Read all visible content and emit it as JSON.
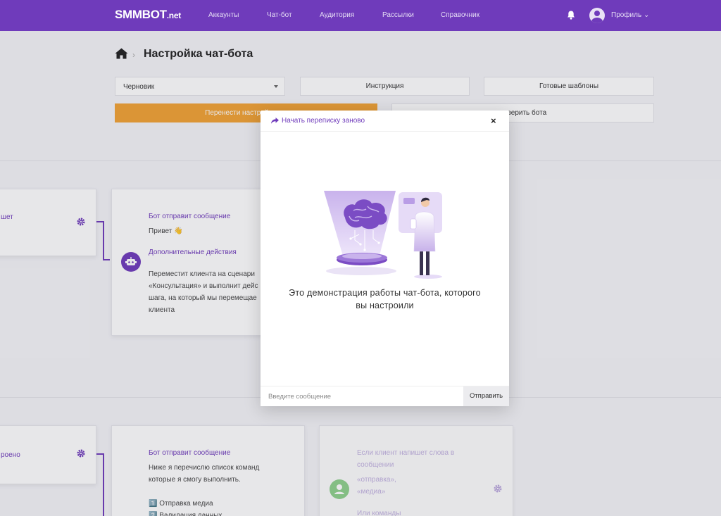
{
  "nav": {
    "brand_main": "SMMBOT",
    "brand_suffix": ".net",
    "links": [
      "Аккаунты",
      "Чат-бот",
      "Аудитория",
      "Рассылки",
      "Справочник"
    ],
    "profile": "Профиль ⌄",
    "accent": "#6f3bbb"
  },
  "page": {
    "title": "Настройка чат-бота"
  },
  "controls": {
    "draft_select": "Черновик",
    "instruction": "Инструкция",
    "templates": "Готовые шаблоны",
    "transfer": "Перенести настройки в о",
    "check_bot": "оверить бота"
  },
  "flow": {
    "left_top_label": "шет",
    "left_bottom_label": "роено",
    "card1": {
      "title": "Бот отправит сообщение",
      "greeting": "Привет 👋",
      "actions_title": "Дополнительные действия",
      "lines": [
        "Переместит клиента на сценари",
        "«Консультация» и выполнит дейс",
        "шага, на который мы перемещае",
        "клиента"
      ]
    },
    "card2": {
      "title": "Бот отправит сообщение",
      "lines": [
        "Ниже я перечислю список команд",
        "которые я смогу выполнить.",
        "",
        "1️⃣ Отправка медиа",
        "2️⃣ Валидация данных"
      ]
    },
    "card3": {
      "lines": [
        "Если клиент напишет слова в",
        "сообщении",
        "«отправка»,",
        "«медиа»",
        "",
        "Или команды"
      ]
    }
  },
  "modal": {
    "restart": "Начать переписку заново",
    "close": "×",
    "demo_line1": "Это демонстрация работы чат-бота, которого",
    "demo_line2": "вы настроили",
    "input_placeholder": "Введите сообщение",
    "send": "Отправить"
  }
}
